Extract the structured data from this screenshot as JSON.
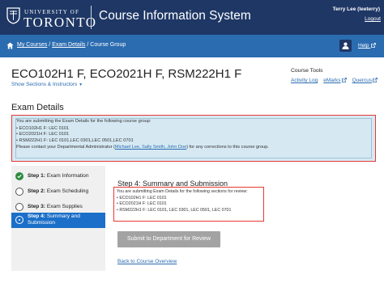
{
  "header": {
    "logo_top": "UNIVERSITY OF",
    "logo_main": "TORONTO",
    "app_title": "Course Information System",
    "user": "Terry Lee (leeterry)",
    "logout": "Logout"
  },
  "nav": {
    "breadcrumb": {
      "my_courses": "My Courses",
      "sep1": " / ",
      "exam_details": "Exam Details",
      "sep2": " / ",
      "current": "Course Group"
    },
    "help": "Help"
  },
  "course": {
    "title": "ECO102H1 F, ECO2021H F, RSM222H1 F",
    "show_sections": "Show Sections & Instructors"
  },
  "course_tools": {
    "title": "Course Tools",
    "links": [
      "Activity Log",
      "eMarks",
      "Quercus"
    ]
  },
  "exam": {
    "heading": "Exam Details",
    "info_intro": "You are submitting the Exam Details for the following course group:",
    "info_items": [
      "ECO102H1 F: LEC 0101",
      "ECO2021H F: LEC 0101",
      "RSM222H1 F: LEC 0101,LEC 0301,LEC 0501,LEC 0701"
    ],
    "contact_prefix": "Please contact your Departmental Administrator (",
    "contact_names": "Michael Lee, Sally Smith, John Doe",
    "contact_suffix": ") for any corrections to this course group."
  },
  "steps": [
    {
      "num": "Step 1:",
      "label": "Exam Information",
      "state": "done"
    },
    {
      "num": "Step 2:",
      "label": "Exam Scheduling",
      "state": "pending"
    },
    {
      "num": "Step 3:",
      "label": "Exam Supplies",
      "state": "pending"
    },
    {
      "num": "Step 4:",
      "label": "Summary and",
      "label2": "Submission",
      "state": "active"
    }
  ],
  "summary": {
    "heading": "Step 4: Summary and Submission",
    "intro": "You are submitting Exam Details for the following sections for review:",
    "items": [
      "ECO102H1 F: LEC 0101",
      "ECO2021H F: LEC 0101",
      "RSM222H1 F: LEC 0101, LEC 0301, LEC 0501, LEC 0701"
    ],
    "submit": "Submit to Department for Review",
    "back": "Back to Course Overview"
  },
  "colors": {
    "header_bg": "#1e3765",
    "nav_bg": "#2b6cb0",
    "info_bg": "#d6e9f3",
    "highlight_border": "#e53935",
    "step_active": "#1b6fc8",
    "step_done": "#2e8b3e",
    "submit_disabled": "#a3a3a3"
  }
}
